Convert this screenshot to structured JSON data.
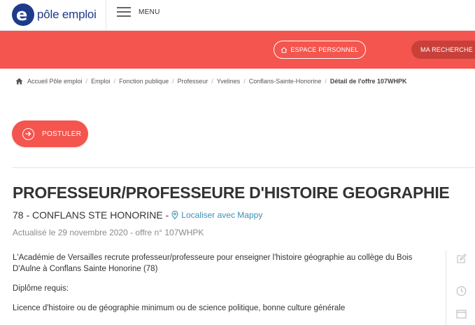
{
  "header": {
    "logo_text": "pôle emploi",
    "menu_label": "MENU"
  },
  "band": {
    "espace_label": "ESPACE PERSONNEL",
    "recherche_label": "MA RECHERCHE D"
  },
  "breadcrumb": {
    "items": [
      "Accueil Pôle emploi",
      "Emploi",
      "Fonction publique",
      "Professeur",
      "Yvelines",
      "Conflans-Sainte-Honorine"
    ],
    "current": "Détail de l'offre 107WHPK"
  },
  "actions": {
    "postuler_label": "POSTULER"
  },
  "offer": {
    "title": "PROFESSEUR/PROFESSEURE D'HISTOIRE GEOGRAPHIE",
    "location": "78 - CONFLANS STE HONORINE -",
    "map_link": "Localiser avec Mappy",
    "updated": "Actualisé le 29 novembre 2020 - offre n° 107WHPK",
    "description": [
      "L'Académie de Versailles recrute  professeur/professeure pour enseigner l'histoire géographie au collège du Bois D'Aulne à Conflans Sainte Honorine (78)",
      "Diplôme requis:",
      "Licence d'histoire ou de géographie minimum ou de science politique, bonne culture générale"
    ]
  },
  "colors": {
    "brand_red": "#f4554e",
    "brand_blue": "#1e3a8a",
    "link_blue": "#3d8fb5"
  },
  "icons": [
    "home-icon",
    "arrow-circle-icon",
    "map-pin-icon",
    "edit-icon",
    "clock-icon",
    "window-icon"
  ]
}
